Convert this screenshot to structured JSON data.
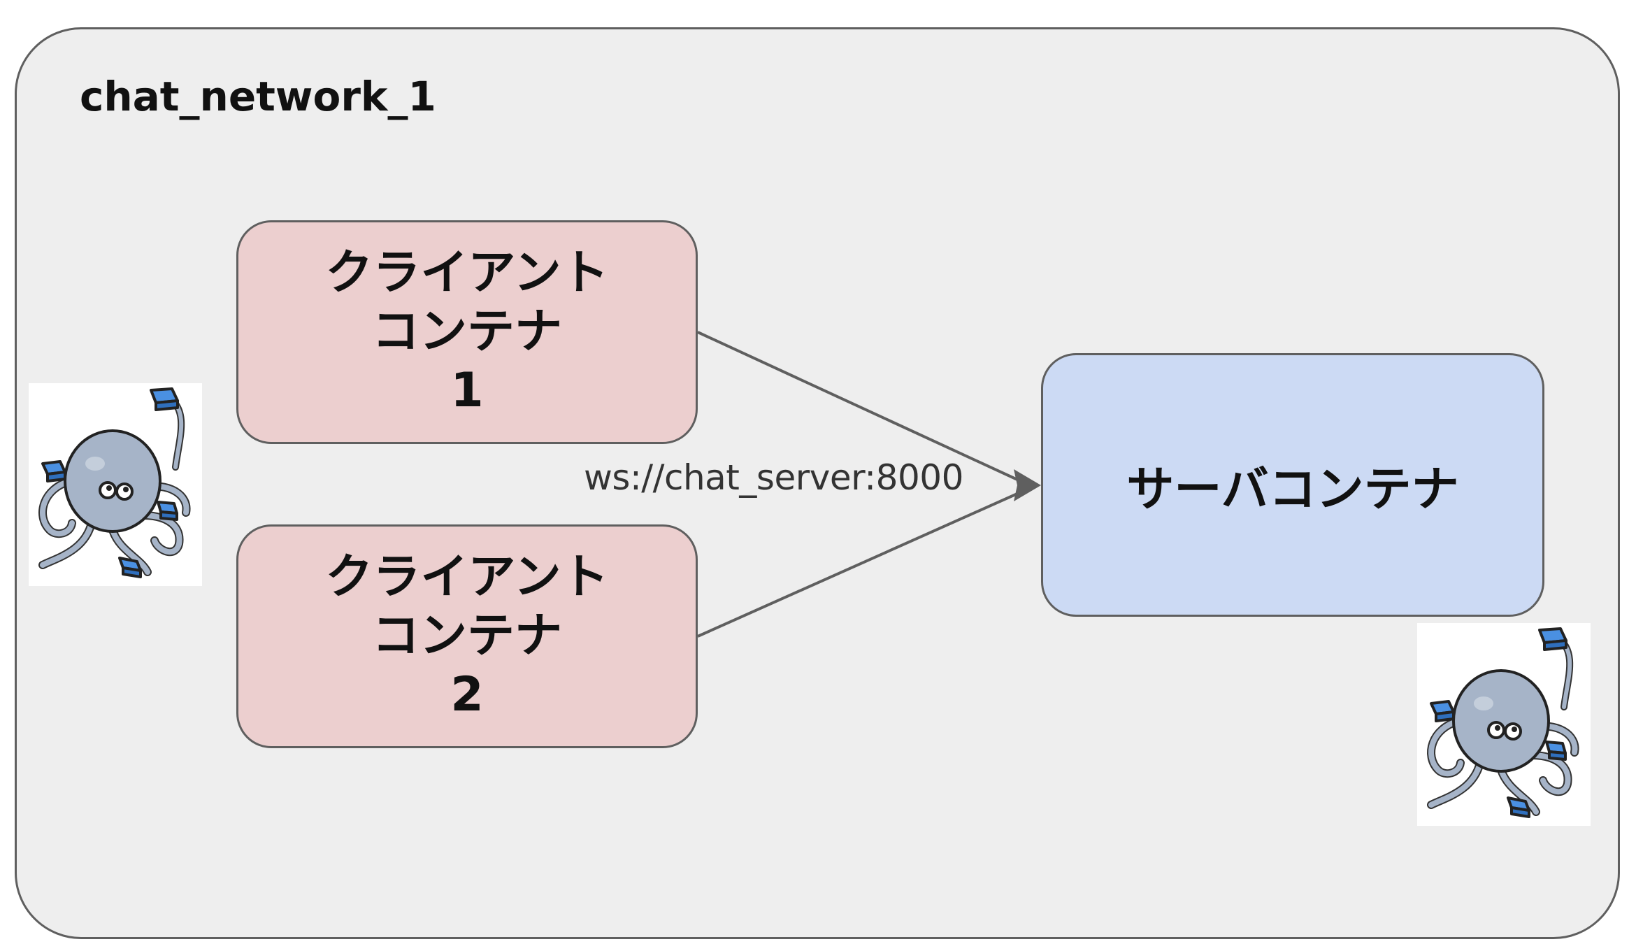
{
  "network": {
    "label": "chat_network_1"
  },
  "clients": [
    {
      "lines": [
        "クライアント",
        "コンテナ",
        "1"
      ]
    },
    {
      "lines": [
        "クライアント",
        "コンテナ",
        "2"
      ]
    }
  ],
  "server": {
    "label": "サーバコンテナ"
  },
  "edge": {
    "label": "ws://chat_server:8000"
  },
  "logos": [
    {
      "icon": "docker-compose-octopus-icon"
    },
    {
      "icon": "docker-compose-octopus-icon"
    }
  ],
  "colors": {
    "network_bg": "#eeeeee",
    "client_fill": "#eccfcf",
    "server_fill": "#ccdaf4",
    "stroke": "#5f5f5f",
    "container_blue": "#4a90e2",
    "octopus_gray": "#a6b4c8"
  }
}
